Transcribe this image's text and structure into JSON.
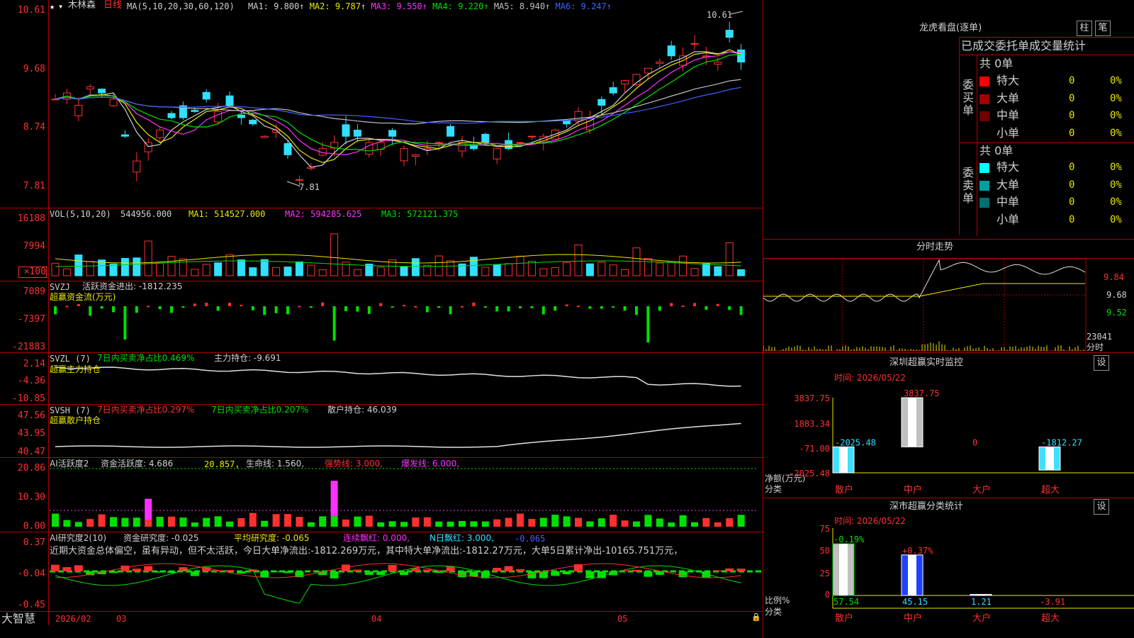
{
  "main": {
    "stock_name": "木林森",
    "period": "日线",
    "ma_label": "MA(5,10,20,30,60,120)",
    "ma_values": [
      {
        "label": "MA1:",
        "value": "9.800",
        "color": "#d0d0d0"
      },
      {
        "label": "MA2:",
        "value": "9.787",
        "color": "#e8e800"
      },
      {
        "label": "MA3:",
        "value": "9.550",
        "color": "#ff30ff"
      },
      {
        "label": "MA4:",
        "value": "9.220",
        "color": "#00e000"
      },
      {
        "label": "MA5:",
        "value": "8.940",
        "color": "#c0c0c0"
      },
      {
        "label": "MA6:",
        "value": "9.247",
        "color": "#4060ff"
      }
    ],
    "y_ticks": [
      "10.61",
      "9.68",
      "8.74",
      "7.81"
    ],
    "high_marker": "10.61",
    "low_marker": "7.81"
  },
  "vol": {
    "label": "VOL(5,10,20)",
    "value": "544956.000",
    "ma1": "MA1: 514527.000",
    "ma2": "MA2: 594285.625",
    "ma3": "MA3: 572121.375",
    "y_ticks": [
      "16188",
      "7994",
      "×100"
    ]
  },
  "svzj": {
    "label": "SVZJ",
    "title": "活跃资金进出: -1812.235",
    "sub": "超赢资金流(万元)",
    "y_ticks": [
      "7089",
      "-7397",
      "-21883"
    ]
  },
  "svzl": {
    "label": "SVZL (7)",
    "p1": "7日内买卖净占比0.469%",
    "p2": "主力持仓: -9.691",
    "sub": "超赢主力持仓",
    "y_ticks": [
      "2.14",
      "-4.36",
      "-10.85"
    ]
  },
  "svsh": {
    "label": "SVSH (7)",
    "p1": "7日内买卖净占比0.297%",
    "p2": "7日内买卖净占比0.207%",
    "p3": "散户持仓: 46.039",
    "sub": "超赢散户持仓",
    "y_ticks": [
      "47.56",
      "43.95",
      "40.47"
    ]
  },
  "ai1": {
    "label": "AI活跃度2",
    "p1": "资金活跃度: 4.686",
    "p2": "20.857,",
    "p3": "生命线: 1.560,",
    "p4": "强势线: 3.000,",
    "p5": "爆发线: 6.000,",
    "y_ticks": [
      "20.86",
      "10.30",
      "0.00"
    ]
  },
  "ai2": {
    "label": "AI研究度2(10)",
    "p1": "资金研究度: -0.025",
    "p2": "平均研究度: -0.065",
    "p3": "连续飘红: 0.000,",
    "p4": "N日飘红: 3.000,",
    "p5": "-0.065",
    "comment": "近期大资金总体偏空，虽有异动，但不太活跃，今日大单净流出:-1812.269万元，其中特大单净流出:-1812.27万元，大单5日累计净出-10165.751万元，",
    "y_ticks": [
      "0.37",
      "-0.04",
      "-0.45"
    ]
  },
  "bottom": {
    "app_name": "大智慧",
    "dates": [
      "2026/02",
      "03",
      "04",
      "05"
    ]
  },
  "right": {
    "lhb_title": "龙虎看盘(逐单)",
    "btn1": "柱",
    "btn2": "笔",
    "tabs": [
      "已成交",
      "委托单",
      "成交量统计"
    ],
    "buy": {
      "side": "委买单",
      "total": "共 0单",
      "rows": [
        {
          "label": "特大",
          "count": "0",
          "pct": "0%",
          "color": "#ff0000"
        },
        {
          "label": "大单",
          "count": "0",
          "pct": "0%",
          "color": "#a00000"
        },
        {
          "label": "中单",
          "count": "0",
          "pct": "0%",
          "color": "#700000"
        },
        {
          "label": "小单",
          "count": "0",
          "pct": "0%",
          "color": "#000000"
        }
      ]
    },
    "sell": {
      "side": "委卖单",
      "total": "共 0单",
      "rows": [
        {
          "label": "特大",
          "count": "0",
          "pct": "0%",
          "color": "#00ffff"
        },
        {
          "label": "大单",
          "count": "0",
          "pct": "0%",
          "color": "#00a0a0"
        },
        {
          "label": "中单",
          "count": "0",
          "pct": "0%",
          "color": "#007070"
        },
        {
          "label": "小单",
          "count": "0",
          "pct": "0%",
          "color": "#000000"
        }
      ]
    },
    "intraday": {
      "title": "分时走势",
      "price_ticks": [
        "9.84",
        "9.68",
        "9.52"
      ],
      "vol_tick": "23041",
      "unit": "分时"
    },
    "monitor": {
      "title": "深圳超赢实时监控",
      "btn": "设",
      "time": "时间: 2026/05/22",
      "y_ticks": [
        "3837.75",
        "1883.34",
        "-71.00",
        "-2025.48"
      ],
      "ylabel": "净额(万元)",
      "xlabel": "分类",
      "chart_data": {
        "type": "bar",
        "categories": [
          "散户",
          "中户",
          "大户",
          "超大"
        ],
        "values": [
          -2025.48,
          3837.75,
          0,
          -1812.27
        ],
        "labels": [
          "-2025.48",
          "3837.75",
          "0",
          "-1812.27"
        ],
        "ylim": [
          -2025.48,
          3837.75
        ]
      }
    },
    "stats": {
      "title": "深市超赢分类统计",
      "btn": "设",
      "time": "时间: 2026/05/22",
      "y_ticks": [
        "75",
        "50",
        "25",
        "0"
      ],
      "ylabel": "比例%",
      "xlabel": "分类",
      "chart_data": {
        "type": "bar",
        "categories": [
          "散户",
          "中户",
          "大户",
          "超大"
        ],
        "values": [
          57.54,
          45.15,
          1.21,
          -3.91
        ],
        "changes": [
          "-0.19%",
          "+0.37%",
          "",
          ""
        ],
        "labels": [
          "57.54",
          "45.15",
          "1.21",
          "-3.91"
        ],
        "ylim": [
          0,
          75
        ]
      }
    }
  }
}
